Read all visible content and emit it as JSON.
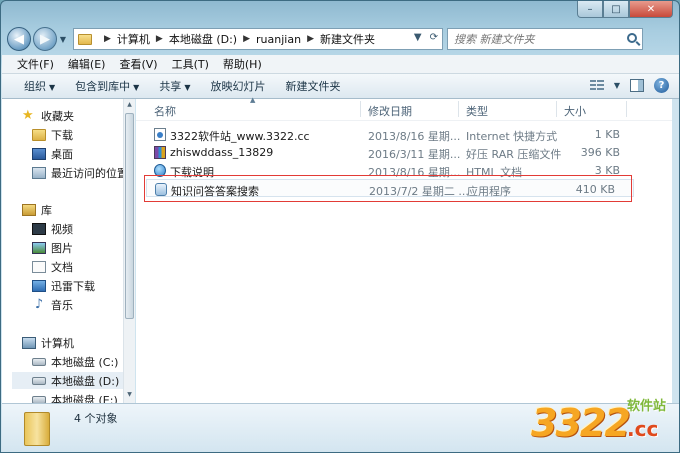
{
  "window": {
    "caption_min": "–",
    "caption_max": "□",
    "caption_close": "✕"
  },
  "nav": {
    "breadcrumbs": [
      "计算机",
      "本地磁盘 (D:)",
      "ruanjian",
      "新建文件夹"
    ],
    "search_placeholder": "搜索 新建文件夹"
  },
  "menu": [
    "文件(F)",
    "编辑(E)",
    "查看(V)",
    "工具(T)",
    "帮助(H)"
  ],
  "commands": [
    {
      "label": "组织",
      "has_dropdown": true
    },
    {
      "label": "包含到库中",
      "has_dropdown": true
    },
    {
      "label": "共享",
      "has_dropdown": true
    },
    {
      "label": "放映幻灯片",
      "has_dropdown": false
    },
    {
      "label": "新建文件夹",
      "has_dropdown": false
    }
  ],
  "sidebar": {
    "favorites": {
      "label": "收藏夹",
      "items": [
        "下载",
        "桌面",
        "最近访问的位置"
      ]
    },
    "libraries": {
      "label": "库",
      "items": [
        "视频",
        "图片",
        "文档",
        "迅雷下载",
        "音乐"
      ]
    },
    "computer": {
      "label": "计算机",
      "items": [
        "本地磁盘 (C:)",
        "本地磁盘 (D:)",
        "本地磁盘 (E:)"
      ]
    }
  },
  "columns": {
    "name": "名称",
    "date": "修改日期",
    "type": "类型",
    "size": "大小"
  },
  "files": [
    {
      "name": "3322软件站_www.3322.cc",
      "date": "2013/8/16 星期...",
      "type": "Internet 快捷方式",
      "size": "1 KB",
      "icon": "url-icon"
    },
    {
      "name": "zhiswddass_13829",
      "date": "2016/3/11 星期...",
      "type": "好压 RAR 压缩文件",
      "size": "396 KB",
      "icon": "rar-icon"
    },
    {
      "name": "下载说明",
      "date": "2013/8/16 星期...",
      "type": "HTML 文档",
      "size": "3 KB",
      "icon": "html-icon"
    },
    {
      "name": "知识问答答案搜索",
      "date": "2013/7/2 星期二 ...",
      "type": "应用程序",
      "size": "410 KB",
      "icon": "exe-icon"
    }
  ],
  "status": {
    "count": "4 个对象"
  },
  "watermark": {
    "number": "3322",
    "text_top": "软件站",
    "text_bottom": ".cc"
  },
  "colors": {
    "highlight_border": "#e23b36",
    "accent": "#3d6b82"
  }
}
